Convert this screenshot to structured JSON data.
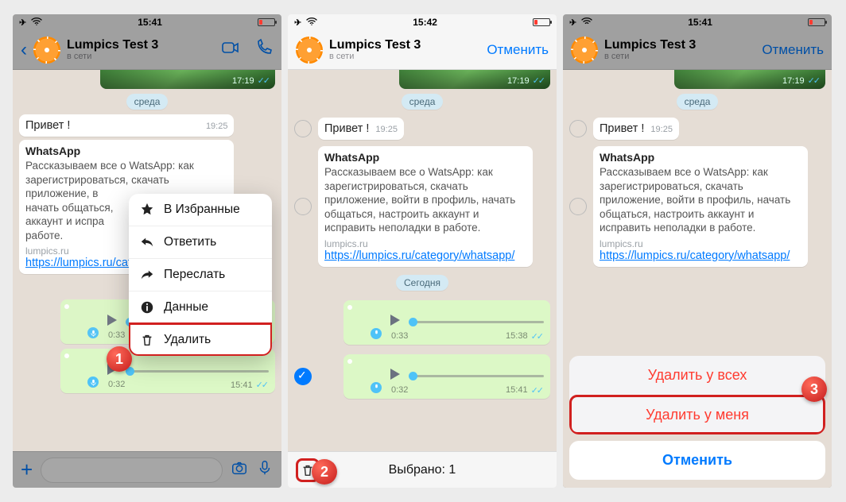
{
  "status": {
    "t1": "15:41",
    "t2": "15:42",
    "t3": "15:41"
  },
  "chat": {
    "name": "Lumpics Test 3",
    "sub": "в сети",
    "cancel": "Отменить",
    "day1": "среда",
    "today": "Сегодня",
    "hi": "Привет !",
    "hi_time": "19:25",
    "wtitle": "WhatsApp",
    "wdesc_short": "Рассказываем все о WatsApp: как зарегистрироваться, скачать приложение, в",
    "wdesc_full": "Рассказываем все о WatsApp: как зарегистрироваться, скачать приложение, войти в профиль, начать общаться, настроить аккаунт и исправить неполадки в работе.",
    "site": "lumpics.ru",
    "link_short": "https://lumpics.ru/category/whatsapp/",
    "img_time": "17:19",
    "voice": {
      "dur1": "0:33",
      "t1": "15:38",
      "dur2": "0:32",
      "t2": "15:41"
    }
  },
  "menu": {
    "fav": "В Избранные",
    "reply": "Ответить",
    "fwd": "Переслать",
    "info": "Данные",
    "del": "Удалить"
  },
  "selbar": {
    "count": "Выбрано: 1"
  },
  "sheet": {
    "all": "Удалить у всех",
    "me": "Удалить у меня",
    "cancel": "Отменить"
  },
  "steps": {
    "s1": "1",
    "s2": "2",
    "s3": "3"
  }
}
